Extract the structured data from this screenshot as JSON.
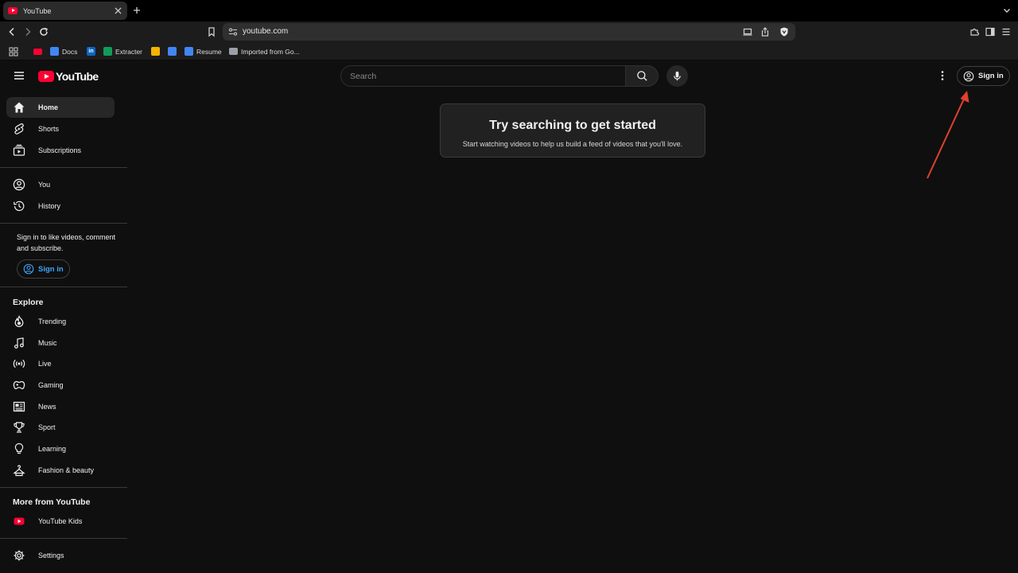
{
  "browser": {
    "tab_title": "YouTube",
    "url": "youtube.com",
    "bookmarks": [
      {
        "label": "",
        "icon": "youtube-icon",
        "color": "#ff0033"
      },
      {
        "label": "Docs",
        "icon": "docs-icon",
        "color": "#4285f4"
      },
      {
        "label": "",
        "icon": "linkedin-icon",
        "color": "#0a66c2"
      },
      {
        "label": "Extracter",
        "icon": "sheets-icon",
        "color": "#0f9d58"
      },
      {
        "label": "",
        "icon": "keep-icon",
        "color": "#f4b400"
      },
      {
        "label": "",
        "icon": "docs-icon",
        "color": "#4285f4"
      },
      {
        "label": "Resume",
        "icon": "docs-icon",
        "color": "#4285f4"
      },
      {
        "label": "Imported from Go...",
        "icon": "folder-icon",
        "color": "#9aa0a6"
      }
    ]
  },
  "masthead": {
    "logo_text": "YouTube",
    "search_placeholder": "Search",
    "sign_in_label": "Sign in"
  },
  "sidebar": {
    "primary": [
      {
        "label": "Home",
        "icon": "home-icon",
        "active": true
      },
      {
        "label": "Shorts",
        "icon": "shorts-icon"
      },
      {
        "label": "Subscriptions",
        "icon": "subscriptions-icon"
      }
    ],
    "you": [
      {
        "label": "You",
        "icon": "account-circle-icon"
      },
      {
        "label": "History",
        "icon": "history-icon"
      }
    ],
    "signin_prompt": "Sign in to like videos, comment and subscribe.",
    "signin_label": "Sign in",
    "explore_title": "Explore",
    "explore": [
      {
        "label": "Trending",
        "icon": "trending-icon"
      },
      {
        "label": "Music",
        "icon": "music-icon"
      },
      {
        "label": "Live",
        "icon": "live-icon"
      },
      {
        "label": "Gaming",
        "icon": "gaming-icon"
      },
      {
        "label": "News",
        "icon": "news-icon"
      },
      {
        "label": "Sport",
        "icon": "trophy-icon"
      },
      {
        "label": "Learning",
        "icon": "lightbulb-icon"
      },
      {
        "label": "Fashion & beauty",
        "icon": "hanger-icon"
      }
    ],
    "more_title": "More from YouTube",
    "more": [
      {
        "label": "YouTube Kids",
        "icon": "youtube-kids-icon"
      }
    ],
    "settings": [
      {
        "label": "Settings",
        "icon": "gear-icon"
      }
    ]
  },
  "main": {
    "empty_title": "Try searching to get started",
    "empty_subtitle": "Start watching videos to help us build a feed of videos that you'll love."
  },
  "colors": {
    "background": "#0f0f0f",
    "brand_red": "#ff0033",
    "link_blue": "#3ea6ff",
    "annotation_arrow": "#e0412f"
  }
}
